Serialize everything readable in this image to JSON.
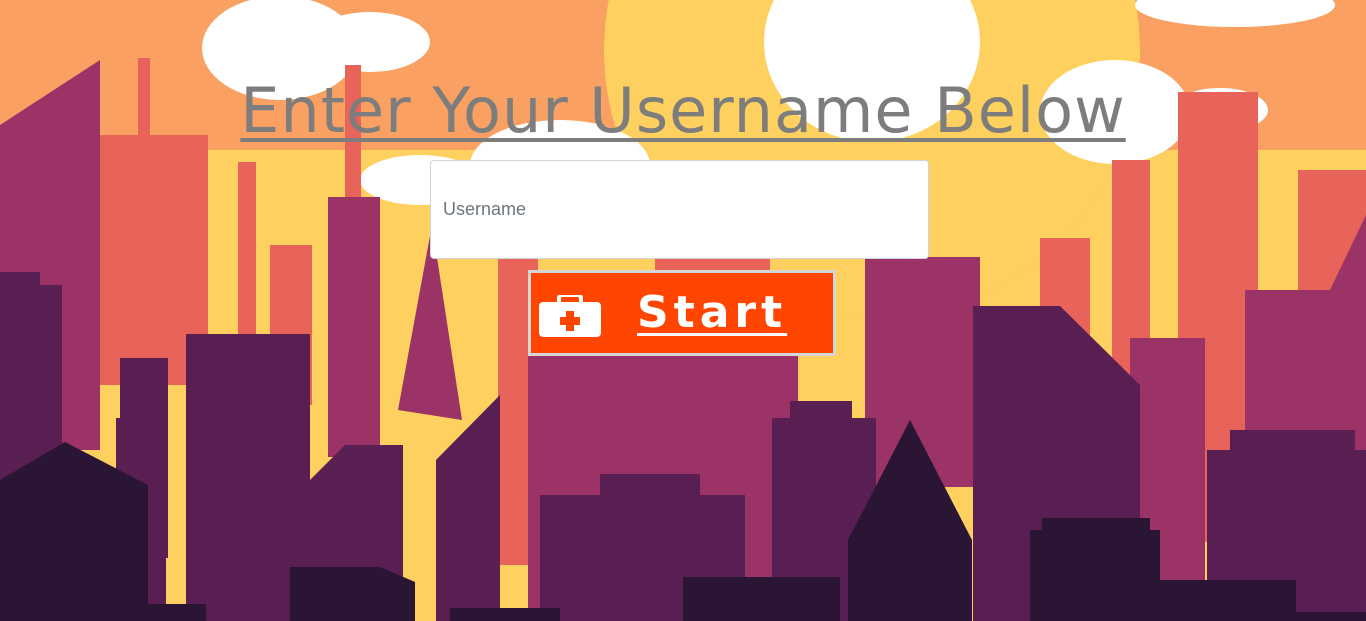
{
  "heading": "Enter Your Username Below",
  "username_input": {
    "placeholder": "Username",
    "value": ""
  },
  "start_button": {
    "label": "Start",
    "icon": "first-aid-kit-icon"
  },
  "colors": {
    "sky": "#f9a062",
    "sun": "#fdd05f",
    "cloud": "#ffffff",
    "building_light": "#e8635a",
    "building_mid": "#9b3366",
    "building_dark": "#5a1f52",
    "building_darkest": "#2b1534",
    "heading_text": "#7d7d7d",
    "button_bg": "#ff4500"
  }
}
